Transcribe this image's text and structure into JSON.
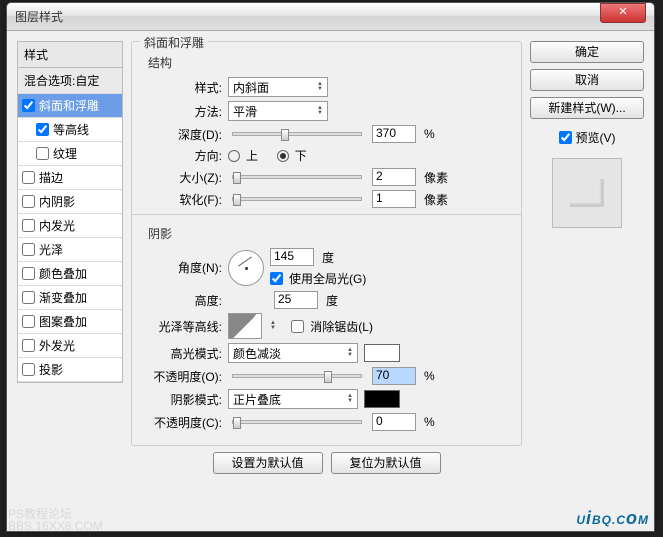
{
  "window": {
    "title": "图层样式"
  },
  "leftpanel": {
    "header": "样式",
    "blend": "混合选项:自定",
    "items": [
      {
        "label": "斜面和浮雕",
        "checked": true,
        "selected": true
      },
      {
        "label": "等高线",
        "checked": true,
        "sub": true
      },
      {
        "label": "纹理",
        "checked": false,
        "sub": true
      },
      {
        "label": "描边",
        "checked": false
      },
      {
        "label": "内阴影",
        "checked": false
      },
      {
        "label": "内发光",
        "checked": false
      },
      {
        "label": "光泽",
        "checked": false
      },
      {
        "label": "颜色叠加",
        "checked": false
      },
      {
        "label": "渐变叠加",
        "checked": false
      },
      {
        "label": "图案叠加",
        "checked": false
      },
      {
        "label": "外发光",
        "checked": false
      },
      {
        "label": "投影",
        "checked": false
      }
    ]
  },
  "group": {
    "title": "斜面和浮雕",
    "structure": {
      "title": "结构",
      "style_label": "样式:",
      "style_value": "内斜面",
      "technique_label": "方法:",
      "technique_value": "平滑",
      "depth_label": "深度(D):",
      "depth_value": "370",
      "depth_unit": "%",
      "direction_label": "方向:",
      "direction_up": "上",
      "direction_down": "下",
      "size_label": "大小(Z):",
      "size_value": "2",
      "size_unit": "像素",
      "soften_label": "软化(F):",
      "soften_value": "1",
      "soften_unit": "像素"
    },
    "shading": {
      "title": "阴影",
      "angle_label": "角度(N):",
      "angle_value": "145",
      "angle_unit": "度",
      "global_light": "使用全局光(G)",
      "altitude_label": "高度:",
      "altitude_value": "25",
      "altitude_unit": "度",
      "gloss_label": "光泽等高线:",
      "antialias_label": "消除锯齿(L)",
      "highlight_mode_label": "高光模式:",
      "highlight_mode_value": "颜色减淡",
      "highlight_opacity_label": "不透明度(O):",
      "highlight_opacity_value": "70",
      "pct": "%",
      "shadow_mode_label": "阴影模式:",
      "shadow_mode_value": "正片叠底",
      "shadow_opacity_label": "不透明度(C):",
      "shadow_opacity_value": "0"
    },
    "defaults": {
      "make": "设置为默认值",
      "reset": "复位为默认值"
    }
  },
  "right": {
    "ok": "确定",
    "cancel": "取消",
    "newstyle": "新建样式(W)...",
    "preview": "预览(V)"
  },
  "watermark": {
    "brand_a": "U",
    "brand_b": "i",
    "brand_c": "BQ.C",
    "brand_d": "o",
    "brand_e": "M",
    "small1": "PS教程论坛",
    "small2": "BBS.16XX8.COM"
  }
}
